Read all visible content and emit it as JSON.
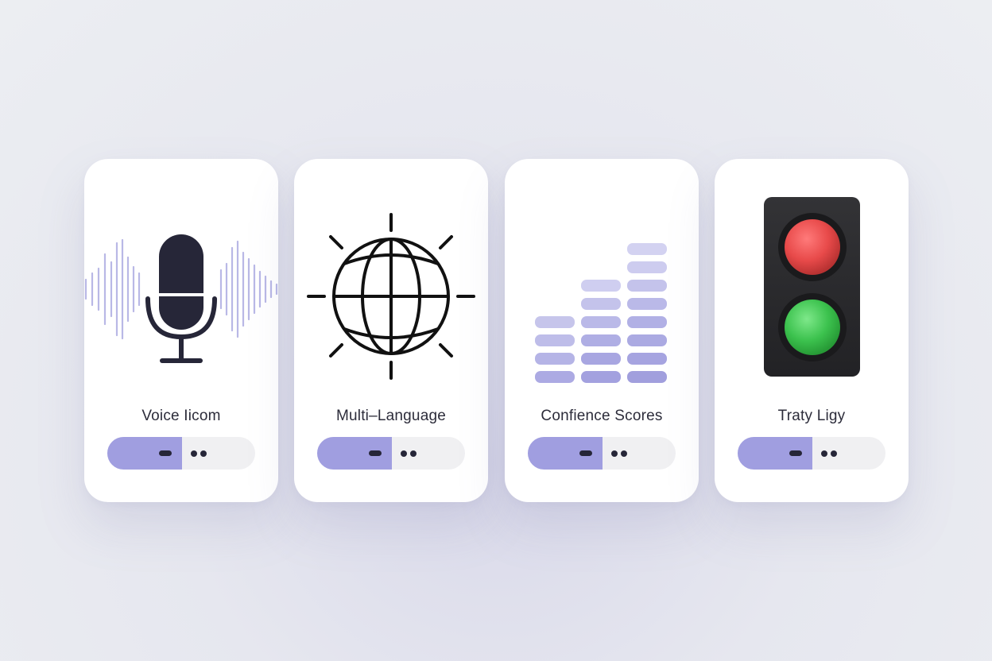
{
  "cards": [
    {
      "label": "Voice Iicom",
      "icon": "microphone-icon",
      "toggle": {
        "state": "on"
      }
    },
    {
      "label": "Multi–Language",
      "icon": "globe-icon",
      "toggle": {
        "state": "on"
      }
    },
    {
      "label": "Confience Scores",
      "icon": "confidence-bars-icon",
      "toggle": {
        "state": "on"
      }
    },
    {
      "label": "Traty Ligy",
      "icon": "traffic-light-icon",
      "toggle": {
        "state": "on"
      }
    }
  ],
  "colors": {
    "accent": "#a09ee0",
    "icon_dark": "#262638",
    "wave": "#b9b8e6",
    "light_red": "#e84a4a",
    "light_green": "#3cc24e",
    "light_housing": "#2a2a2e"
  }
}
